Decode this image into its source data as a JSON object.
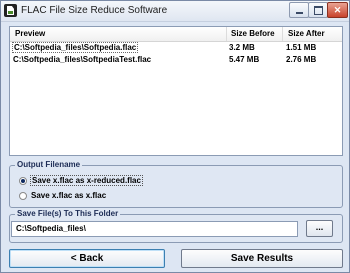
{
  "window": {
    "title": "FLAC File Size Reduce Software"
  },
  "file_list": {
    "columns": [
      "Preview",
      "Size Before",
      "Size After"
    ],
    "rows": [
      {
        "path": "C:\\Softpedia_files\\Softpedia.flac",
        "size_before": "3.2 MB",
        "size_after": "1.51 MB",
        "selected": true
      },
      {
        "path": "C:\\Softpedia_files\\SoftpediaTest.flac",
        "size_before": "5.47 MB",
        "size_after": "2.76 MB",
        "selected": false
      }
    ]
  },
  "output_filename": {
    "title": "Output Filename",
    "options": [
      {
        "label": "Save x.flac as x-reduced.flac",
        "checked": true
      },
      {
        "label": "Save x.flac as x.flac",
        "checked": false
      }
    ]
  },
  "save_folder": {
    "title": "Save File(s) To This Folder",
    "value": "C:\\Softpedia_files\\",
    "browse_label": "..."
  },
  "buttons": {
    "back": "< Back",
    "save": "Save Results"
  }
}
